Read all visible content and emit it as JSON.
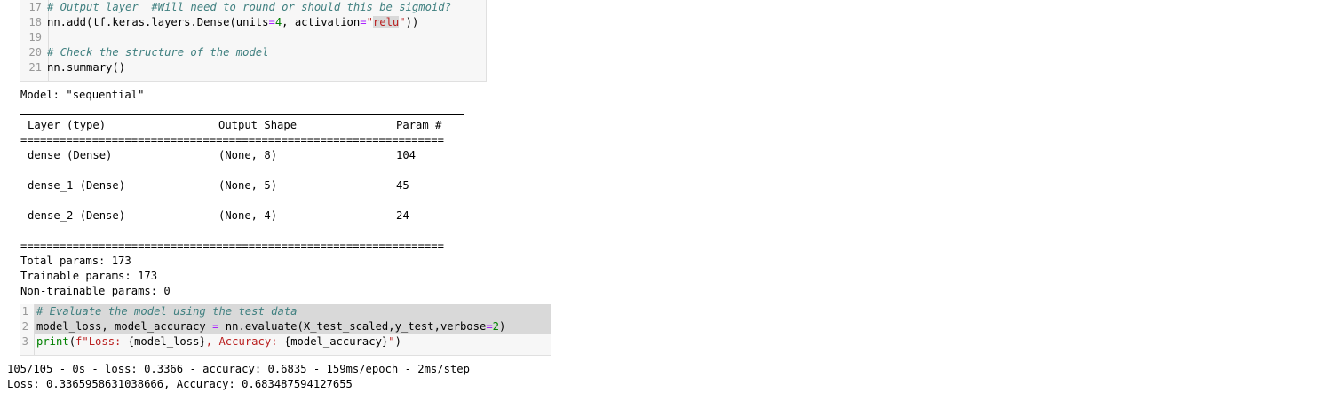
{
  "cell1": {
    "lines": [
      {
        "n": "17",
        "parts": [
          {
            "t": "# Output layer  #Will need to round or should this be sigmoid?",
            "c": "cm"
          }
        ]
      },
      {
        "n": "18",
        "parts": [
          {
            "t": "nn.add(tf.keras.layers.Dense(units",
            "c": ""
          },
          {
            "t": "=",
            "c": "op"
          },
          {
            "t": "4",
            "c": "num"
          },
          {
            "t": ", activation",
            "c": ""
          },
          {
            "t": "=",
            "c": "op"
          },
          {
            "t": "\"",
            "c": "str"
          },
          {
            "t": "relu",
            "c": "str hlstr"
          },
          {
            "t": "\"",
            "c": "str"
          },
          {
            "t": "))",
            "c": ""
          }
        ]
      },
      {
        "n": "19",
        "parts": []
      },
      {
        "n": "20",
        "parts": [
          {
            "t": "# Check the structure of the model",
            "c": "cm"
          }
        ]
      },
      {
        "n": "21",
        "parts": [
          {
            "t": "nn.summary()",
            "c": ""
          }
        ]
      }
    ]
  },
  "summary": {
    "model_title": "Model: \"sequential\"",
    "headers": {
      "layer": "Layer (type)",
      "shape": "Output Shape",
      "params": "Param #"
    },
    "rows": [
      {
        "layer": "dense (Dense)",
        "shape": "(None, 8)",
        "params": "104"
      },
      {
        "layer": "dense_1 (Dense)",
        "shape": "(None, 5)",
        "params": "45"
      },
      {
        "layer": "dense_2 (Dense)",
        "shape": "(None, 4)",
        "params": "24"
      }
    ],
    "eq_rule": "=================================================================",
    "total": "Total params: 173",
    "trainable": "Trainable params: 173",
    "non_trainable": "Non-trainable params: 0"
  },
  "cell2": {
    "lines": [
      {
        "n": "1",
        "parts": [
          {
            "t": "# Evaluate the model using the test data",
            "c": "cm"
          }
        ]
      },
      {
        "n": "2",
        "parts": [
          {
            "t": "model_loss, model_accuracy ",
            "c": ""
          },
          {
            "t": "=",
            "c": "op"
          },
          {
            "t": " nn.evaluate(X_test_scaled,y_test,verbose",
            "c": ""
          },
          {
            "t": "=",
            "c": "op"
          },
          {
            "t": "2",
            "c": "num"
          },
          {
            "t": ")",
            "c": ""
          }
        ]
      },
      {
        "n": "3",
        "parts": [
          {
            "t": "print",
            "c": "num"
          },
          {
            "t": "(",
            "c": ""
          },
          {
            "t": "f\"Loss: ",
            "c": "str"
          },
          {
            "t": "{model_loss}",
            "c": ""
          },
          {
            "t": ", Accuracy: ",
            "c": "str"
          },
          {
            "t": "{model_accuracy}",
            "c": ""
          },
          {
            "t": "\"",
            "c": "str"
          },
          {
            "t": ")",
            "c": ""
          }
        ]
      }
    ]
  },
  "eval_output": {
    "line1": "105/105 - 0s - loss: 0.3366 - accuracy: 0.6835 - 159ms/epoch - 2ms/step",
    "line2": "Loss: 0.3365958631038666, Accuracy: 0.683487594127655"
  }
}
